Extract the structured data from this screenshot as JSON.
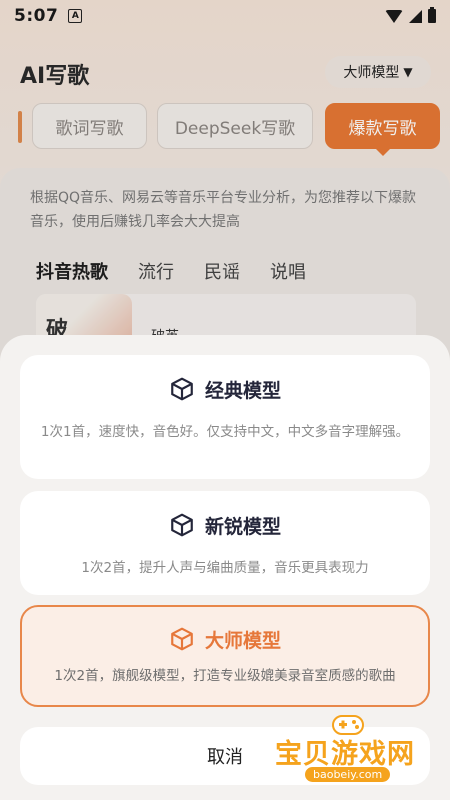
{
  "status_bar": {
    "time": "5:07",
    "notification_badge": "A"
  },
  "header": {
    "title": "AI写歌",
    "model_selector_label": "大师模型",
    "model_selector_caret": "▼"
  },
  "mode_tabs": [
    {
      "label": "歌词写歌",
      "active": false
    },
    {
      "label": "DeepSeek写歌",
      "active": false
    },
    {
      "label": "爆款写歌",
      "active": true
    }
  ],
  "recommend": {
    "description": "根据QQ音乐、网易云等音乐平台专业分析，为您推荐以下爆款音乐，使用后赚钱几率会大大提高"
  },
  "genre_tabs": [
    {
      "label": "抖音热歌",
      "active": true
    },
    {
      "label": "流行",
      "active": false
    },
    {
      "label": "民谣",
      "active": false
    },
    {
      "label": "说唱",
      "active": false
    }
  ],
  "song_list": [
    {
      "cover_text": "破",
      "title": "破茧"
    }
  ],
  "model_sheet": {
    "options": [
      {
        "title": "经典模型",
        "description": "1次1首，速度快，音色好。仅支持中文，中文多音字理解强。",
        "selected": false,
        "icon": "cube-icon"
      },
      {
        "title": "新锐模型",
        "description": "1次2首，提升人声与编曲质量，音乐更具表现力",
        "selected": false,
        "icon": "cube-icon"
      },
      {
        "title": "大师模型",
        "description": "1次2首，旗舰级模型，打造专业级媲美录音室质感的歌曲",
        "selected": true,
        "icon": "cube-icon"
      }
    ],
    "cancel_label": "取消"
  },
  "watermark": {
    "text": "宝贝游戏网",
    "domain": "baobeiy.com"
  },
  "colors": {
    "accent": "#e67835",
    "selected_border": "#e8874a",
    "selected_bg": "#fbeee6",
    "title_dark": "#24263a",
    "watermark": "#f5a31d"
  }
}
